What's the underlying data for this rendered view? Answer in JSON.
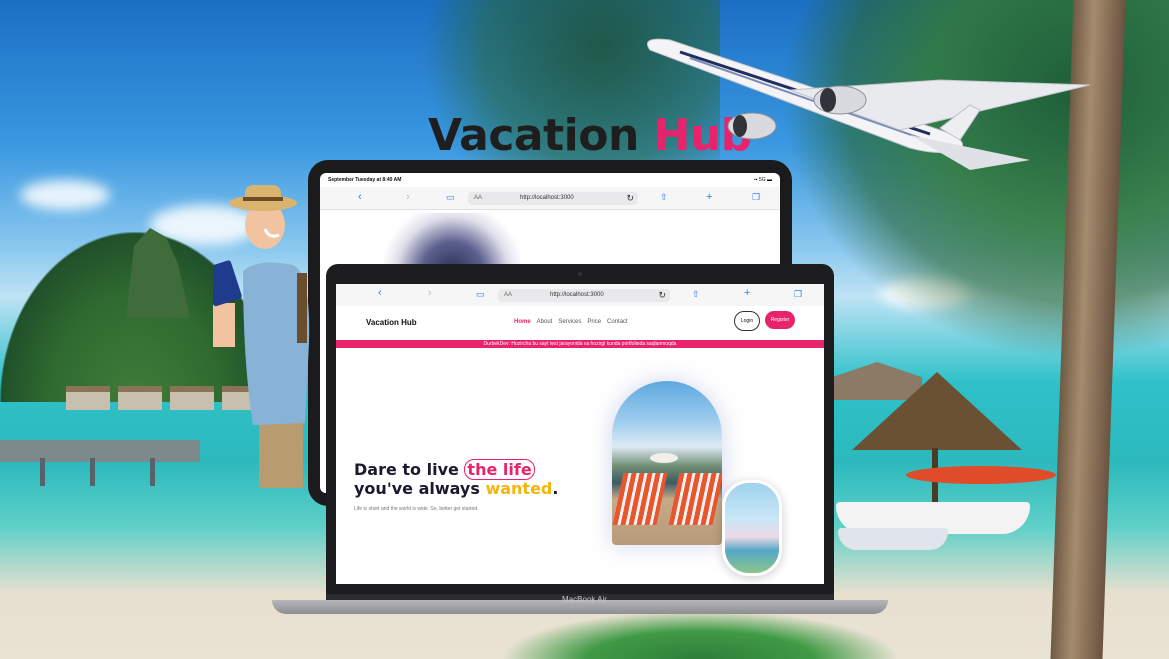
{
  "headline": {
    "word1": "Vacation",
    "word2": "Hub"
  },
  "tablet": {
    "status_left": "September Tuesday at 8:40 AM",
    "status_right": "▪▪ 5G ▬",
    "url_aa": "AA",
    "url": "http://localhost:3000"
  },
  "laptop": {
    "url_aa": "AA",
    "url": "http://localhost:3000",
    "brand_label": "MacBook Air"
  },
  "site": {
    "logo": "Vacation Hub",
    "nav": [
      "Home",
      "About",
      "Services",
      "Price",
      "Contact"
    ],
    "active_nav": "Home",
    "login_label": "Login",
    "register_label": "Register",
    "banner": "DurbekDev: Hozircha bu sayt test jarayonida va hozirgi kunda portfolioda saqlanmoqda",
    "hero": {
      "line1_a": "Dare to live ",
      "line1_b": "the life",
      "line2_a": "you've always ",
      "line2_b": "wanted",
      "line2_c": ".",
      "subtitle": "Life is short and the world is wide. So, better get started."
    }
  },
  "colors": {
    "accent": "#e8226b",
    "highlight": "#f5b50a",
    "dark": "#1e1e1e"
  },
  "icons": [
    "back-icon",
    "forward-icon",
    "book-icon",
    "lock-icon",
    "reload-icon",
    "share-icon",
    "plus-icon",
    "tabs-icon",
    "airplane-icon"
  ]
}
